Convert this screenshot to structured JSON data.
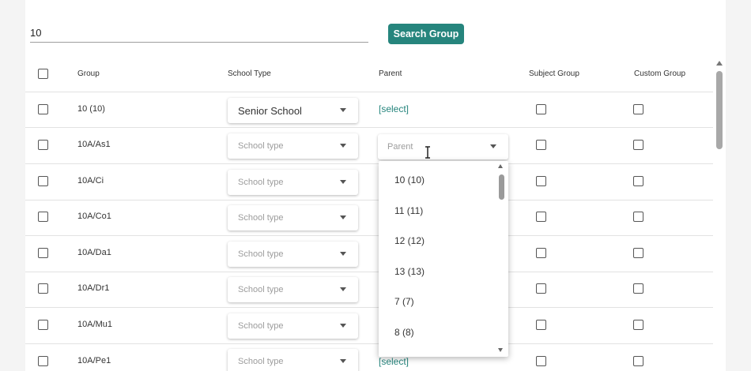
{
  "search": {
    "value": "10",
    "button_label": "Search Group"
  },
  "table": {
    "headers": {
      "group": "Group",
      "school_type": "School Type",
      "parent": "Parent",
      "subject_group": "Subject Group",
      "custom_group": "Custom Group"
    },
    "rows": [
      {
        "group": "10 (10)",
        "school_type": "Senior School",
        "school_type_placeholder": "",
        "parent": "[select]"
      },
      {
        "group": "10A/As1",
        "school_type": "",
        "school_type_placeholder": "School type",
        "parent": ""
      },
      {
        "group": "10A/Ci",
        "school_type": "",
        "school_type_placeholder": "School type",
        "parent": ""
      },
      {
        "group": "10A/Co1",
        "school_type": "",
        "school_type_placeholder": "School type",
        "parent": ""
      },
      {
        "group": "10A/Da1",
        "school_type": "",
        "school_type_placeholder": "School type",
        "parent": ""
      },
      {
        "group": "10A/Dr1",
        "school_type": "",
        "school_type_placeholder": "School type",
        "parent": ""
      },
      {
        "group": "10A/Mu1",
        "school_type": "",
        "school_type_placeholder": "School type",
        "parent": ""
      },
      {
        "group": "10A/Pe1",
        "school_type": "",
        "school_type_placeholder": "School type",
        "parent": "[select]"
      }
    ]
  },
  "parent_dropdown": {
    "placeholder": "Parent",
    "options": [
      "10 (10)",
      "11 (11)",
      "12 (12)",
      "13 (13)",
      "7 (7)",
      "8 (8)"
    ]
  },
  "colors": {
    "accent": "#26857d"
  },
  "icons": {
    "dropdown_caret": "chevron-down-icon",
    "cursor": "text-cursor-icon"
  }
}
